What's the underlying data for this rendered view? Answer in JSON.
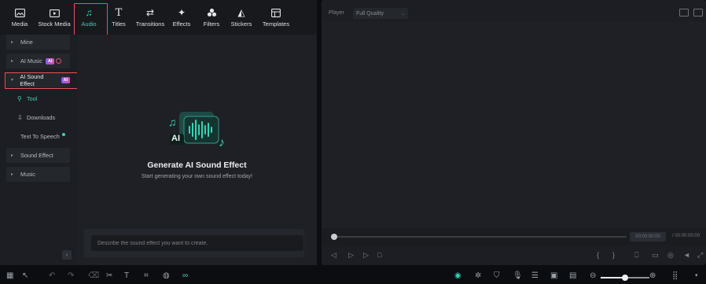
{
  "toolbar": {
    "tabs": [
      {
        "label": "Media",
        "icon": "media-icon"
      },
      {
        "label": "Stock Media",
        "icon": "stock-media-icon"
      },
      {
        "label": "Audio",
        "icon": "music-note-icon",
        "active": true
      },
      {
        "label": "Titles",
        "icon": "titles-icon"
      },
      {
        "label": "Transitions",
        "icon": "transitions-icon"
      },
      {
        "label": "Effects",
        "icon": "effects-icon"
      },
      {
        "label": "Filters",
        "icon": "filters-icon"
      },
      {
        "label": "Stickers",
        "icon": "stickers-icon"
      },
      {
        "label": "Templates",
        "icon": "templates-icon"
      }
    ]
  },
  "sidebar": {
    "items": [
      {
        "label": "Mine"
      },
      {
        "label": "AI Music",
        "badge": "AI"
      },
      {
        "label": "AI Sound Effect",
        "badge": "AI",
        "selected": true
      },
      {
        "label": "Tool"
      },
      {
        "label": "Downloads"
      },
      {
        "label": "Text To Speech"
      },
      {
        "label": "Sound Effect"
      },
      {
        "label": "Music"
      }
    ]
  },
  "main": {
    "hero_art_label": "AI",
    "title": "Generate AI Sound Effect",
    "subtitle": "Start generating your own sound effect today!",
    "prompt_placeholder": "Describe the sound effect you want to create."
  },
  "player": {
    "label": "Player",
    "quality": "Full Quality",
    "timecode": "00:00:00:00",
    "timecode_total": "/ 00:00:00:00"
  },
  "colors": {
    "accent": "#3ad2b6",
    "highlight": "#e65353",
    "panel": "#1c1e23",
    "background": "#0c0d10"
  },
  "zoom_level": 0.5
}
